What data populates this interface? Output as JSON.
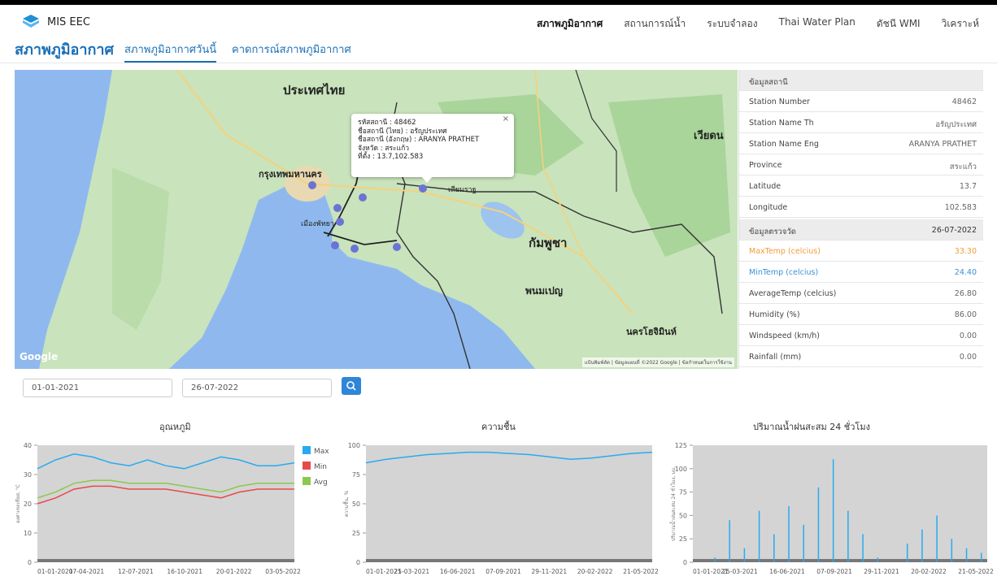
{
  "header": {
    "brand": "MIS EEC",
    "nav": [
      "สภาพภูมิอากาศ",
      "สถานการณ์น้ำ",
      "ระบบจำลอง",
      "Thai Water Plan",
      "ดัชนี WMI",
      "วิเคราะห์"
    ]
  },
  "subheader": {
    "title": "สภาพภูมิอากาศ",
    "tabs": [
      "สภาพภูมิอากาศวันนี้",
      "คาดการณ์สภาพภูมิอากาศ"
    ]
  },
  "map": {
    "labels": {
      "thailand": "ประเทศไทย",
      "bangkok": "กรุงเทพมหานคร",
      "cambodia": "กัมพูชา",
      "vietnam": "เวียดน",
      "phnom_penh": "พนมเปญ",
      "ho_chi_minh": "นครโฮจิมินห์",
      "pattaya": "เมืองพัทยา",
      "siem_reap": "เสียมราฐ"
    },
    "popup": {
      "lines": [
        "รหัสสถานี : 48462",
        "ชื่อสถานี (ไทย) : อรัญประเทศ",
        "ชื่อสถานี (อังกฤษ) : ARANYA PRATHET",
        "จังหวัด : สระแก้ว",
        "ที่ตั้ง : 13.7,102.583"
      ],
      "close": "×"
    },
    "google": "Google",
    "credit": "แป้นพิมพ์ลัด | ข้อมูลแผนที่ ©2022 Google | ข้อกำหนดในการใช้งาน"
  },
  "station_panel": {
    "header": "ข้อมูลสถานี",
    "rows": [
      {
        "label": "Station Number",
        "value": "48462"
      },
      {
        "label": "Station Name Th",
        "value": "อรัญประเทศ"
      },
      {
        "label": "Station Name Eng",
        "value": "ARANYA PRATHET"
      },
      {
        "label": "Province",
        "value": "สระแก้ว"
      },
      {
        "label": "Latitude",
        "value": "13.7"
      },
      {
        "label": "Longitude",
        "value": "102.583"
      }
    ],
    "measure_header": "ข้อมูลตรวจวัด",
    "measure_date": "26-07-2022",
    "measures": [
      {
        "label": "MaxTemp (celcius)",
        "value": "33.30"
      },
      {
        "label": "MinTemp (celcius)",
        "value": "24.40"
      },
      {
        "label": "AverageTemp (celcius)",
        "value": "26.80"
      },
      {
        "label": "Humidity (%)",
        "value": "86.00"
      },
      {
        "label": "Windspeed (km/h)",
        "value": "0.00"
      },
      {
        "label": "Rainfall (mm)",
        "value": "0.00"
      }
    ]
  },
  "filters": {
    "start_date": "01-01-2021",
    "end_date": "26-07-2022"
  },
  "colors": {
    "max": "#29aaf0",
    "min": "#e8494b",
    "avg": "#8cc84b",
    "plot_bg": "#d4d4d4",
    "accent": "#1a6fb6"
  },
  "chart_data": [
    {
      "type": "line",
      "title": "อุณหภูมิ",
      "ylabel": "องศาเซลเซียส, °C",
      "ylim": [
        0,
        40
      ],
      "yticks": [
        0,
        10,
        20,
        30,
        40
      ],
      "xticks": [
        "01-01-2021",
        "07-04-2021",
        "12-07-2021",
        "16-10-2021",
        "20-01-2022",
        "03-05-2022"
      ],
      "series": [
        {
          "name": "Max",
          "values": [
            32,
            35,
            37,
            36,
            34,
            33,
            35,
            33,
            32,
            34,
            36,
            35,
            33,
            33,
            34
          ]
        },
        {
          "name": "Min",
          "values": [
            20,
            22,
            25,
            26,
            26,
            25,
            25,
            25,
            24,
            23,
            22,
            24,
            25,
            25,
            25
          ]
        },
        {
          "name": "Avg",
          "values": [
            22,
            24,
            27,
            28,
            28,
            27,
            27,
            27,
            26,
            25,
            24,
            26,
            27,
            27,
            27
          ]
        }
      ]
    },
    {
      "type": "line",
      "title": "ความชื้น",
      "ylabel": "ความชื้น, %",
      "ylim": [
        0,
        100
      ],
      "yticks": [
        0,
        25,
        50,
        75,
        100
      ],
      "xticks": [
        "01-01-2021",
        "25-03-2021",
        "16-06-2021",
        "07-09-2021",
        "29-11-2021",
        "20-02-2022",
        "21-05-2022"
      ],
      "series": [
        {
          "name": "Humidity",
          "values": [
            85,
            88,
            90,
            92,
            93,
            94,
            94,
            93,
            92,
            90,
            88,
            89,
            91,
            93,
            94
          ]
        }
      ]
    },
    {
      "type": "bar",
      "title": "ปริมาณน้ำฝนสะสม 24 ชั่วโมง",
      "ylabel": "ปริมาณน้ำฝนสะสม 24 ชั่วโมง, มม.",
      "ylim": [
        0,
        125
      ],
      "yticks": [
        0,
        25,
        50,
        75,
        100,
        125
      ],
      "xticks": [
        "01-01-2021",
        "25-03-2021",
        "16-06-2021",
        "07-09-2021",
        "29-11-2021",
        "20-02-2022",
        "21-05-2022"
      ],
      "values": [
        0,
        5,
        45,
        15,
        55,
        30,
        60,
        40,
        80,
        110,
        55,
        30,
        5,
        0,
        20,
        35,
        50,
        25,
        15,
        10
      ]
    }
  ]
}
